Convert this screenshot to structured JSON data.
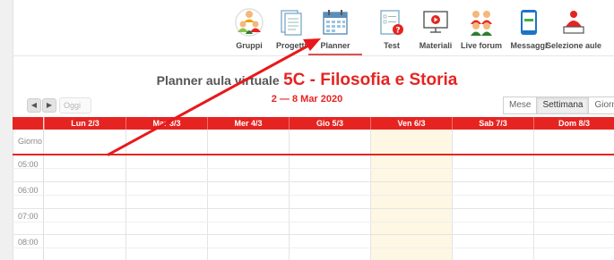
{
  "toolbar": {
    "items": [
      {
        "label": "Gruppi",
        "icon": "group-icon"
      },
      {
        "label": "Progetti",
        "icon": "project-icon"
      },
      {
        "label": "Planner",
        "icon": "calendar-icon"
      },
      {
        "label": "Test",
        "icon": "test-icon"
      },
      {
        "label": "Materiali",
        "icon": "materials-icon"
      },
      {
        "label": "Live forum",
        "icon": "live-forum-icon"
      },
      {
        "label": "Messaggi",
        "icon": "messages-icon"
      },
      {
        "label": "Selezione aule",
        "icon": "classroom-select-icon"
      }
    ],
    "active": "Planner"
  },
  "heading": {
    "prefix": "Planner aula virtuale",
    "class_name": "5C - Filosofia e Storia"
  },
  "date_range": "2 — 8 Mar 2020",
  "nav": {
    "today_label": "Oggi"
  },
  "views": [
    "Mese",
    "Settimana",
    "Giorno"
  ],
  "selected_view": "Settimana",
  "calendar": {
    "days": [
      "Lun 2/3",
      "Mar 3/3",
      "Mer 4/3",
      "Gio 5/3",
      "Ven 6/3",
      "Sab 7/3",
      "Dom 8/3"
    ],
    "today": "Ven 6/3",
    "allday_label": "Giorno",
    "times": [
      "05:00",
      "06:00",
      "07:00",
      "08:00"
    ]
  },
  "colors": {
    "accent": "#e52421",
    "today_bg": "#fdf7e3"
  }
}
